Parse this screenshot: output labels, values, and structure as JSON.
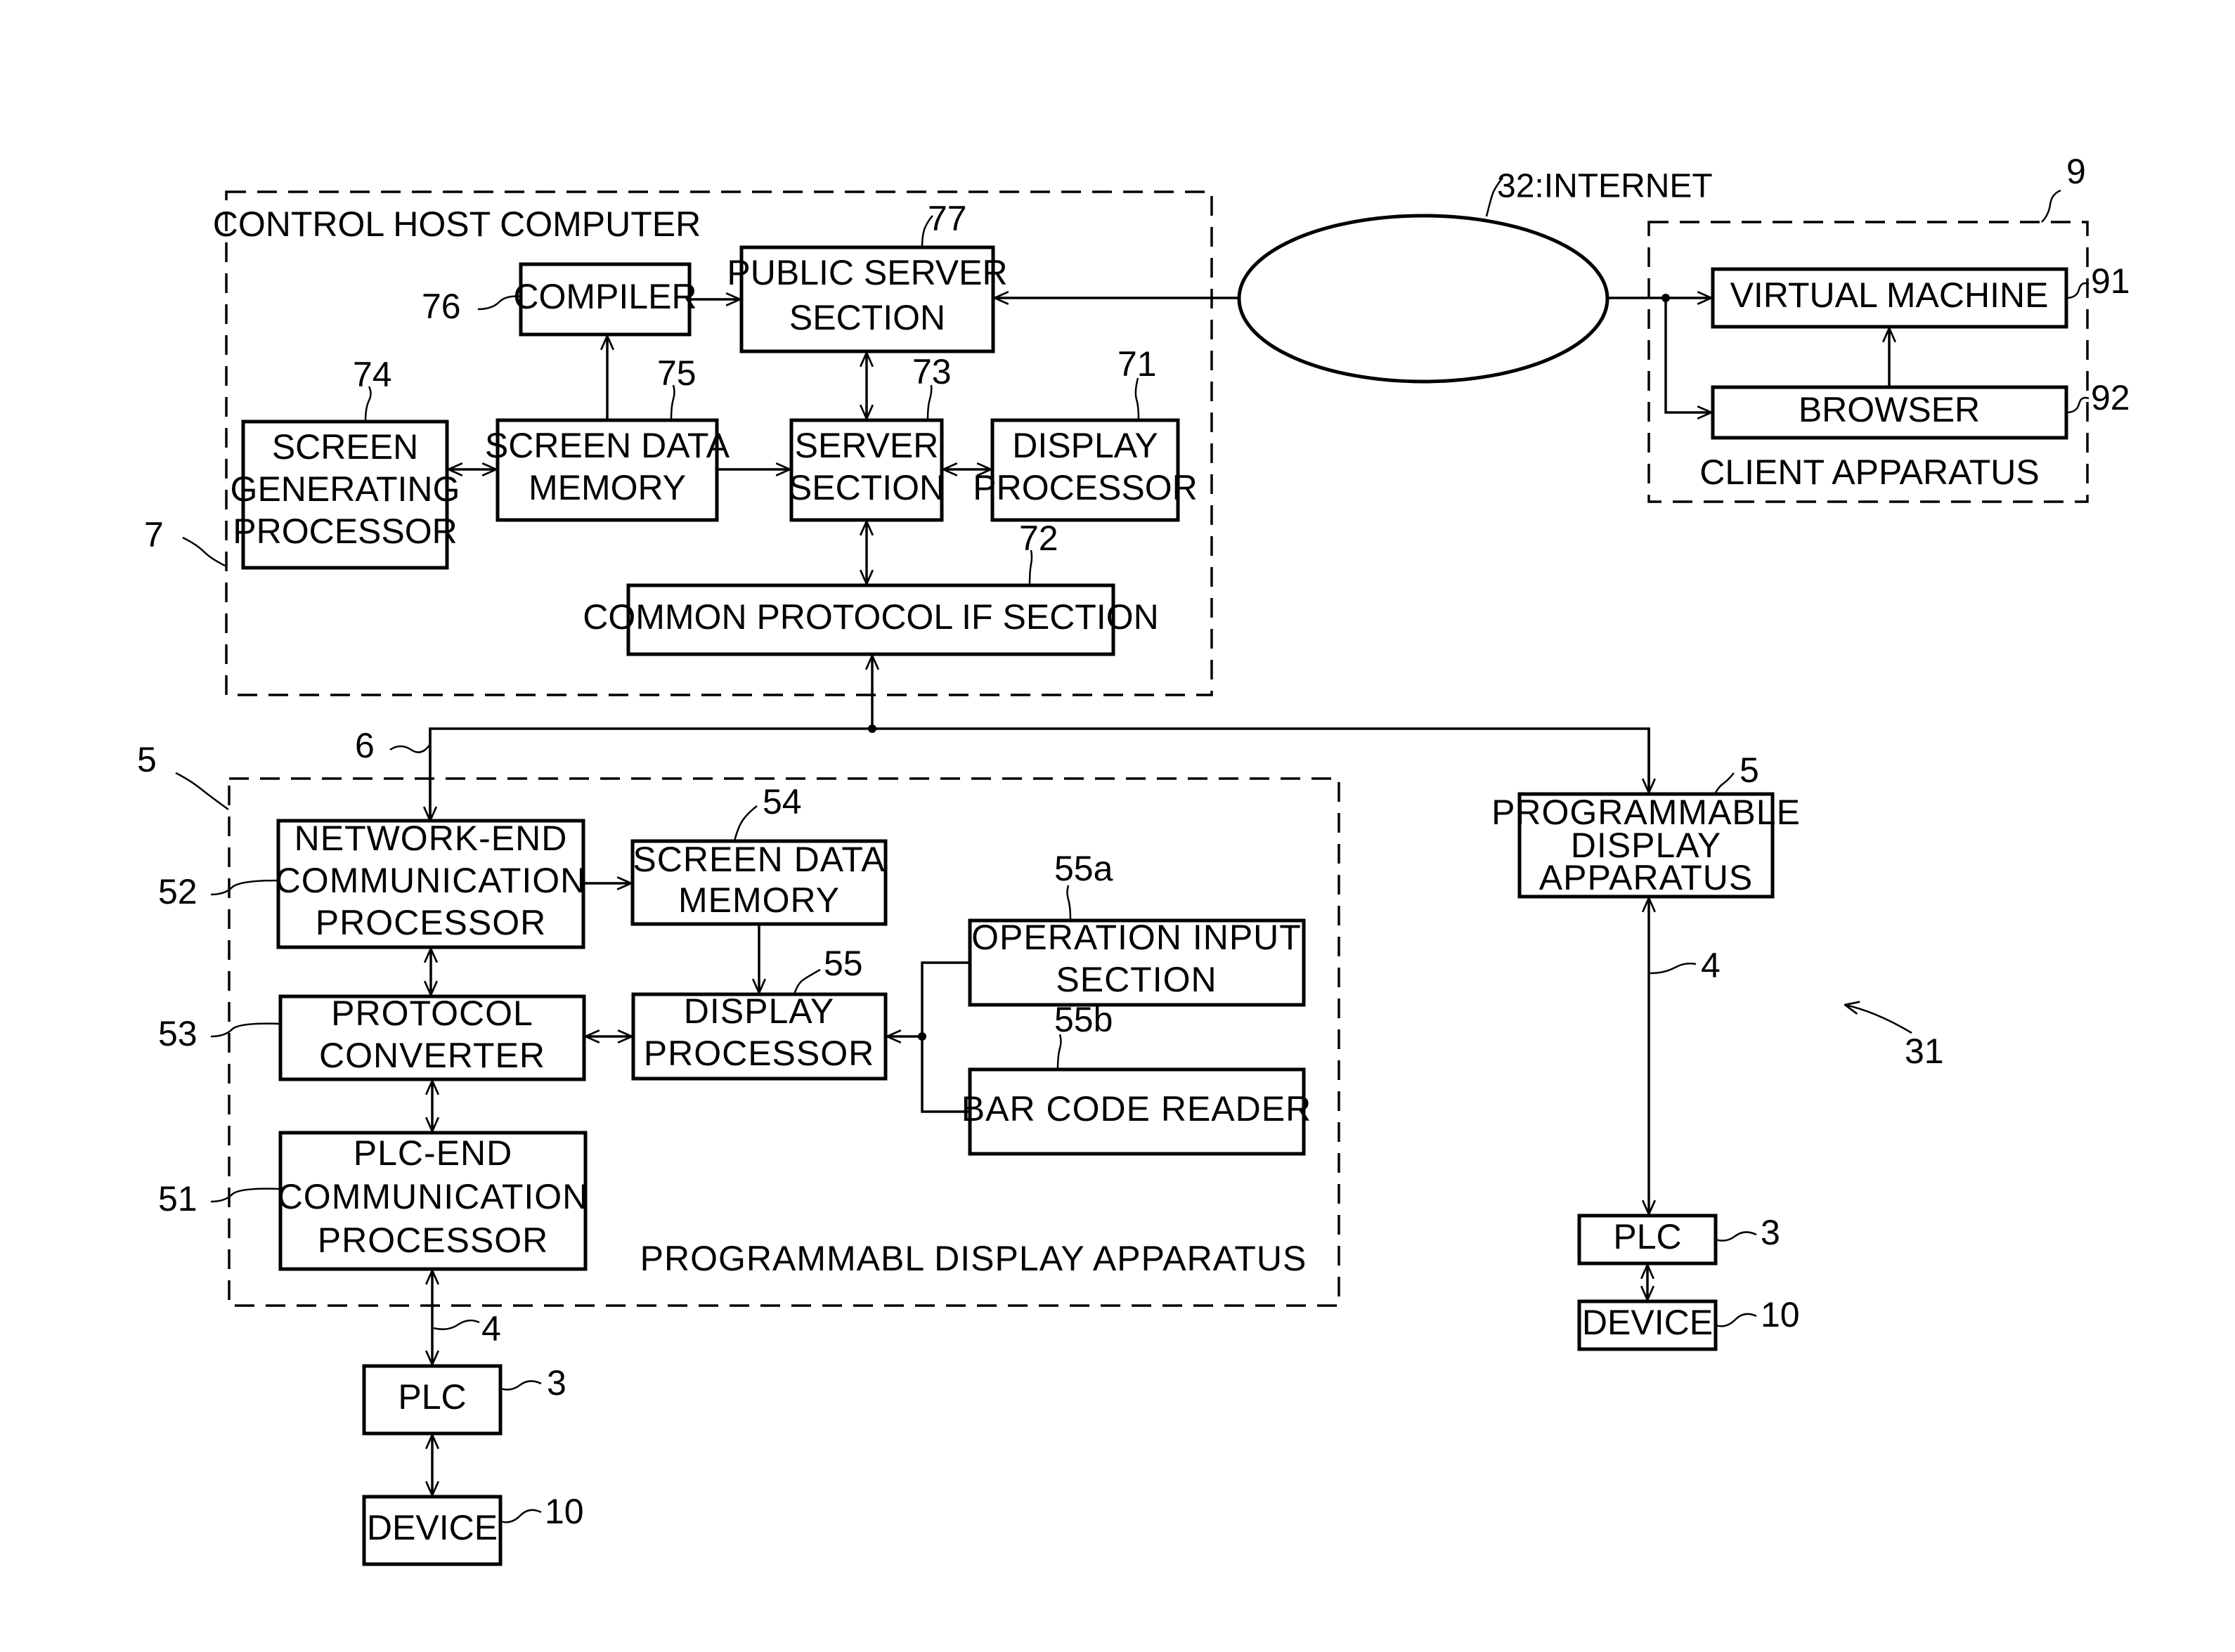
{
  "figure": {
    "type": "block-diagram",
    "system_ref": "31",
    "control_host": {
      "ref": "7",
      "title": "CONTROL HOST COMPUTER",
      "blocks": {
        "compiler": {
          "ref": "76",
          "lines": [
            "COMPILER"
          ]
        },
        "public_server": {
          "ref": "77",
          "lines": [
            "PUBLIC SERVER",
            "SECTION"
          ]
        },
        "screen_generating": {
          "ref": "74",
          "lines": [
            "SCREEN",
            "GENERATING",
            "PROCESSOR"
          ]
        },
        "screen_data_memory": {
          "ref": "75",
          "lines": [
            "SCREEN DATA",
            "MEMORY"
          ]
        },
        "server_section": {
          "ref": "73",
          "lines": [
            "SERVER",
            "SECTION"
          ]
        },
        "display_processor": {
          "ref": "71",
          "lines": [
            "DISPLAY",
            "PROCESSOR"
          ]
        },
        "common_protocol": {
          "ref": "72",
          "lines": [
            "COMMON PROTOCOL IF SECTION"
          ]
        }
      }
    },
    "internet": {
      "label": "32:INTERNET"
    },
    "client": {
      "ref": "9",
      "title": "CLIENT APPARATUS",
      "blocks": {
        "virtual_machine": {
          "ref": "91",
          "lines": [
            "VIRTUAL MACHINE"
          ]
        },
        "browser": {
          "ref": "92",
          "lines": [
            "BROWSER"
          ]
        }
      }
    },
    "network_ref": "6",
    "prog_display": {
      "ref": "5",
      "title": "PROGRAMMABL DISPLAY  APPARATUS",
      "blocks": {
        "network_end": {
          "ref": "52",
          "lines": [
            "NETWORK-END",
            "COMMUNICATION",
            "PROCESSOR"
          ]
        },
        "screen_data_memory": {
          "ref": "54",
          "lines": [
            "SCREEN DATA",
            "MEMORY"
          ]
        },
        "protocol_converter": {
          "ref": "53",
          "lines": [
            "PROTOCOL",
            "CONVERTER"
          ]
        },
        "display_processor": {
          "ref": "55",
          "lines": [
            "DISPLAY",
            "PROCESSOR"
          ]
        },
        "operation_input": {
          "ref": "55a",
          "lines": [
            "OPERATION INPUT",
            "SECTION"
          ]
        },
        "bar_code_reader": {
          "ref": "55b",
          "lines": [
            "BAR CODE READER"
          ]
        },
        "plc_end": {
          "ref": "51",
          "lines": [
            "PLC-END",
            "COMMUNICATION",
            "PROCESSOR"
          ]
        }
      }
    },
    "left_chain": {
      "link_ref": "4",
      "plc": {
        "ref": "3",
        "label": "PLC"
      },
      "device": {
        "ref": "10",
        "label": "DEVICE"
      }
    },
    "right_chain": {
      "display": {
        "ref": "5",
        "lines": [
          "PROGRAMMABLE",
          "DISPLAY",
          "APPARATUS"
        ]
      },
      "link_ref": "4",
      "plc": {
        "ref": "3",
        "label": "PLC"
      },
      "device": {
        "ref": "10",
        "label": "DEVICE"
      }
    }
  }
}
